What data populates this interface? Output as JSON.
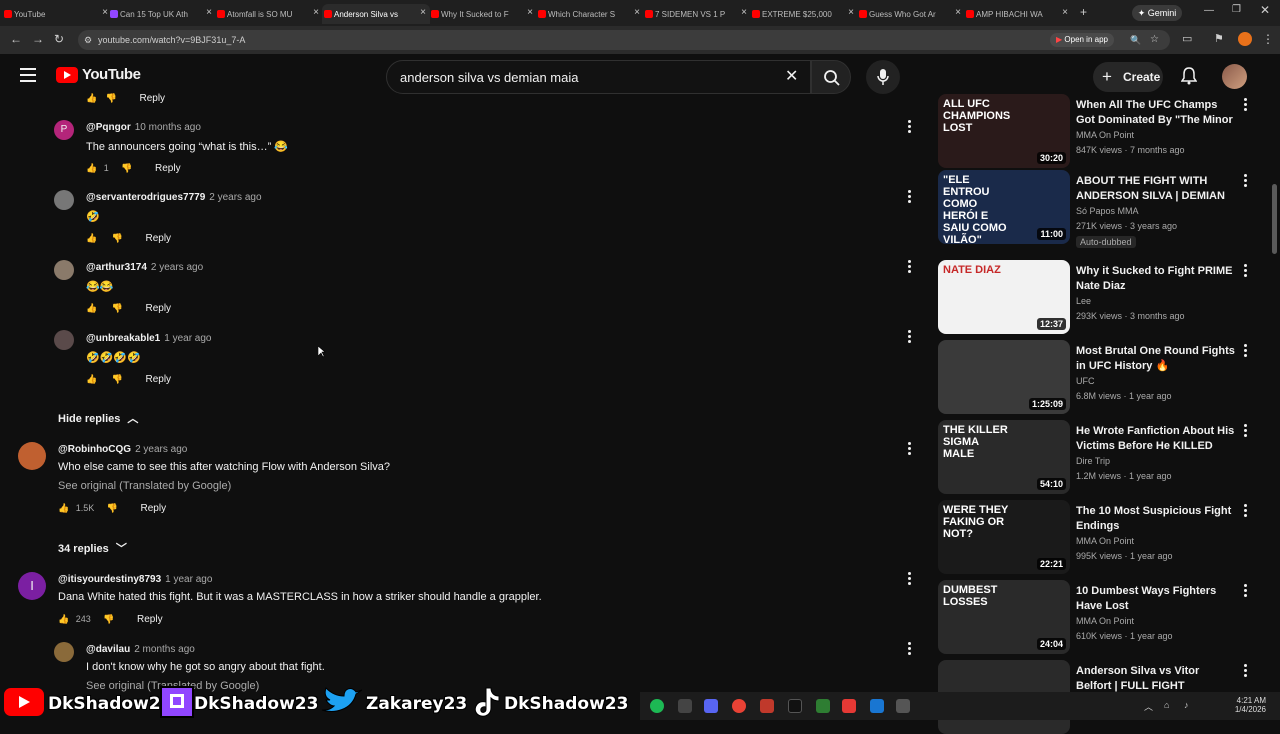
{
  "browser": {
    "tabs": [
      "YouTube",
      "Can 15 Top UK Ath",
      "Atomfall is SO MU",
      "Anderson Silva vs",
      "Why It Sucked to F",
      "Which Character S",
      "7 SIDEMEN VS 1 P",
      "EXTREME $25,000",
      "Guess Who Got Ar",
      "AMP HIBACHI WA"
    ],
    "gemini_label": "Gemini",
    "url": "youtube.com/watch?v=9BJF31u_7-A",
    "open_in_app": "Open in app"
  },
  "header": {
    "logo_text": "YouTube",
    "search_value": "anderson silva vs demian maia",
    "create_label": "Create"
  },
  "comments": {
    "top_reply_label": "Reply",
    "replies": [
      {
        "handle": "@Pqngor",
        "time": "10 months ago",
        "text": "The announcers going “what is this…” 😂",
        "likes": "1",
        "reply": "Reply",
        "avatar_letter": "P",
        "avatar_color": "#b4257a"
      },
      {
        "handle": "@servanterodrigues7779",
        "time": "2 years ago",
        "text": "🤣",
        "likes": "",
        "reply": "Reply",
        "avatar_letter": "",
        "avatar_color": "#777777"
      },
      {
        "handle": "@arthur3174",
        "time": "2 years ago",
        "text": "😂😂",
        "likes": "",
        "reply": "Reply",
        "avatar_letter": "",
        "avatar_color": "#8a7a6a"
      },
      {
        "handle": "@unbreakable1",
        "time": "1 year ago",
        "text": "🤣🤣🤣🤣",
        "likes": "",
        "reply": "Reply",
        "avatar_letter": "",
        "avatar_color": "#5a4a4a"
      }
    ],
    "hide_replies": "Hide replies",
    "threads": [
      {
        "handle": "@RobinhoCQG",
        "time": "2 years ago",
        "text": "Who else came to see this after watching Flow with Anderson Silva?",
        "translate": "See original (Translated by Google)",
        "likes": "1.5K",
        "reply": "Reply",
        "replies_toggle": "34 replies",
        "avatar_color": "#c06030"
      },
      {
        "handle": "@itisyourdestiny8793",
        "time": "1 year ago",
        "text": "Dana White hated this fight. But it was a MASTERCLASS in how a striker should handle a grappler.",
        "likes": "243",
        "reply": "Reply",
        "avatar_letter": "I",
        "avatar_color": "#7b1fa2"
      },
      {
        "handle": "@davilau",
        "time": "2 months ago",
        "text": "I don't know why he got so angry about that fight.",
        "translate": "See original (Translated by Google)",
        "avatar_color": "#8a6a3a"
      }
    ]
  },
  "sidebar": {
    "videos": [
      {
        "title": "When All The UFC Champs Got Dominated By \"The Minor ...",
        "channel": "MMA On Point",
        "meta": "847K views · 7 months ago",
        "duration": "30:20",
        "thumb_text": "ALL UFC CHAMPIONS LOST",
        "thumb_color": "#2a1a1a"
      },
      {
        "title": "ABOUT THE FIGHT WITH ANDERSON SILVA | DEMIAN ...",
        "channel": "Só Papos MMA",
        "meta": "271K views · 3 years ago",
        "badge": "Auto-dubbed",
        "duration": "11:00",
        "thumb_text": "\"ELE ENTROU COMO HERÓI E SAIU COMO VILÃO\"",
        "thumb_color": "#1a2a4a"
      },
      {
        "title": "Why it Sucked to Fight PRIME Nate Diaz",
        "channel": "Lee",
        "meta": "293K views · 3 months ago",
        "duration": "12:37",
        "thumb_text": "NATE DIAZ",
        "thumb_color": "#f2f2f2"
      },
      {
        "title": "Most Brutal One Round Fights in UFC History 🔥",
        "channel": "UFC",
        "meta": "6.8M views · 1 year ago",
        "duration": "1:25:09",
        "thumb_text": "",
        "thumb_color": "#3a3a3a"
      },
      {
        "title": "He Wrote Fanfiction About His Victims Before He KILLED The...",
        "channel": "Dire Trip",
        "meta": "1.2M views · 1 year ago",
        "duration": "54:10",
        "thumb_text": "THE KILLER SIGMA MALE",
        "thumb_color": "#2a2a2a"
      },
      {
        "title": "The 10 Most Suspicious Fight Endings",
        "channel": "MMA On Point",
        "meta": "995K views · 1 year ago",
        "duration": "22:21",
        "thumb_text": "WERE THEY FAKING OR NOT?",
        "thumb_color": "#1a1a1a"
      },
      {
        "title": "10 Dumbest Ways Fighters Have Lost",
        "channel": "MMA On Point",
        "meta": "610K views · 1 year ago",
        "duration": "24:04",
        "thumb_text": "DUMBEST LOSSES",
        "thumb_color": "#2a2a2a"
      },
      {
        "title": "Anderson Silva vs Vitor Belfort | FULL FIGHT",
        "channel": "",
        "meta": "",
        "duration": "",
        "thumb_text": "",
        "thumb_color": "#2a2a2a"
      }
    ]
  },
  "overlay": {
    "names": [
      "DkShadow23",
      "DkShadow23",
      "Zakarey23",
      "DkShadow23"
    ]
  },
  "taskbar": {
    "time": "4:21 AM",
    "date": "1/4/2026"
  }
}
